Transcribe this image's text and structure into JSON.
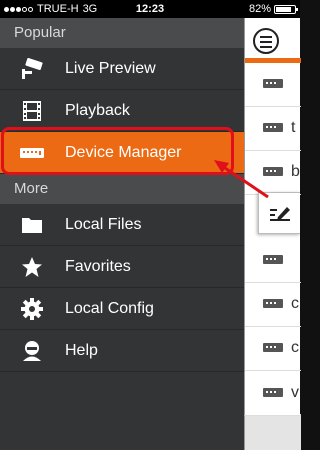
{
  "status_bar": {
    "carrier": "TRUE-H",
    "network": "3G",
    "time": "12:23",
    "battery": "82%",
    "battery_level": 0.82,
    "signal_bars_filled": 3,
    "signal_bars_total": 5
  },
  "drawer": {
    "sections": [
      {
        "header": "Popular",
        "items": [
          {
            "label": "Live Preview",
            "icon": "cctv-camera-icon"
          },
          {
            "label": "Playback",
            "icon": "film-strip-icon"
          },
          {
            "label": "Device Manager",
            "icon": "dvr-device-icon",
            "active": true
          }
        ]
      },
      {
        "header": "More",
        "items": [
          {
            "label": "Local Files",
            "icon": "folder-icon"
          },
          {
            "label": "Favorites",
            "icon": "star-icon"
          },
          {
            "label": "Local Config",
            "icon": "gear-icon"
          },
          {
            "label": "Help",
            "icon": "person-icon"
          }
        ]
      }
    ]
  },
  "content": {
    "rows": [
      {
        "text": ""
      },
      {
        "text": "t"
      },
      {
        "text": "b"
      },
      {
        "text": ""
      },
      {
        "text": "c"
      },
      {
        "text": "c"
      },
      {
        "text": "t"
      },
      {
        "text": "v"
      }
    ]
  },
  "colors": {
    "accent": "#ec6a14",
    "drawer_bg": "#333436",
    "section_header_bg": "#4a4b4d",
    "annotation_red": "#e0101a"
  }
}
